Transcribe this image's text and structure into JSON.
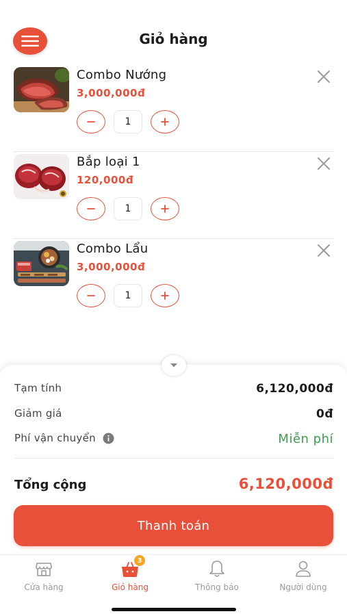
{
  "header": {
    "title": "Giỏ hàng",
    "menu_icon": "hamburger-menu-icon"
  },
  "colors": {
    "accent": "#e8503a",
    "free_shipping": "#3d9e4e",
    "badge": "#f5a623"
  },
  "cart": {
    "items": [
      {
        "name": "Combo Nướng",
        "price": "3,000,000đ",
        "quantity": "1",
        "image": "grilled-beef-image"
      },
      {
        "name": "Bắp loại 1",
        "price": "120,000đ",
        "quantity": "1",
        "image": "raw-beef-shank-image"
      },
      {
        "name": "Combo Lẩu",
        "price": "3,000,000đ",
        "quantity": "1",
        "image": "hotpot-combo-image"
      }
    ]
  },
  "summary": {
    "subtotal_label": "Tạm tính",
    "subtotal_value": "6,120,000đ",
    "discount_label": "Giảm giá",
    "discount_value": "0đ",
    "shipping_label": "Phí vận chuyển",
    "shipping_value": "Miễn phí",
    "total_label": "Tổng cộng",
    "total_value": "6,120,000đ",
    "checkout_label": "Thanh toán"
  },
  "tabbar": {
    "tabs": [
      {
        "label": "Cửa hàng",
        "icon": "store-icon",
        "active": false
      },
      {
        "label": "Giỏ hàng",
        "icon": "basket-icon",
        "active": true,
        "badge": "3"
      },
      {
        "label": "Thông báo",
        "icon": "bell-icon",
        "active": false
      },
      {
        "label": "Người dùng",
        "icon": "user-icon",
        "active": false
      }
    ]
  }
}
